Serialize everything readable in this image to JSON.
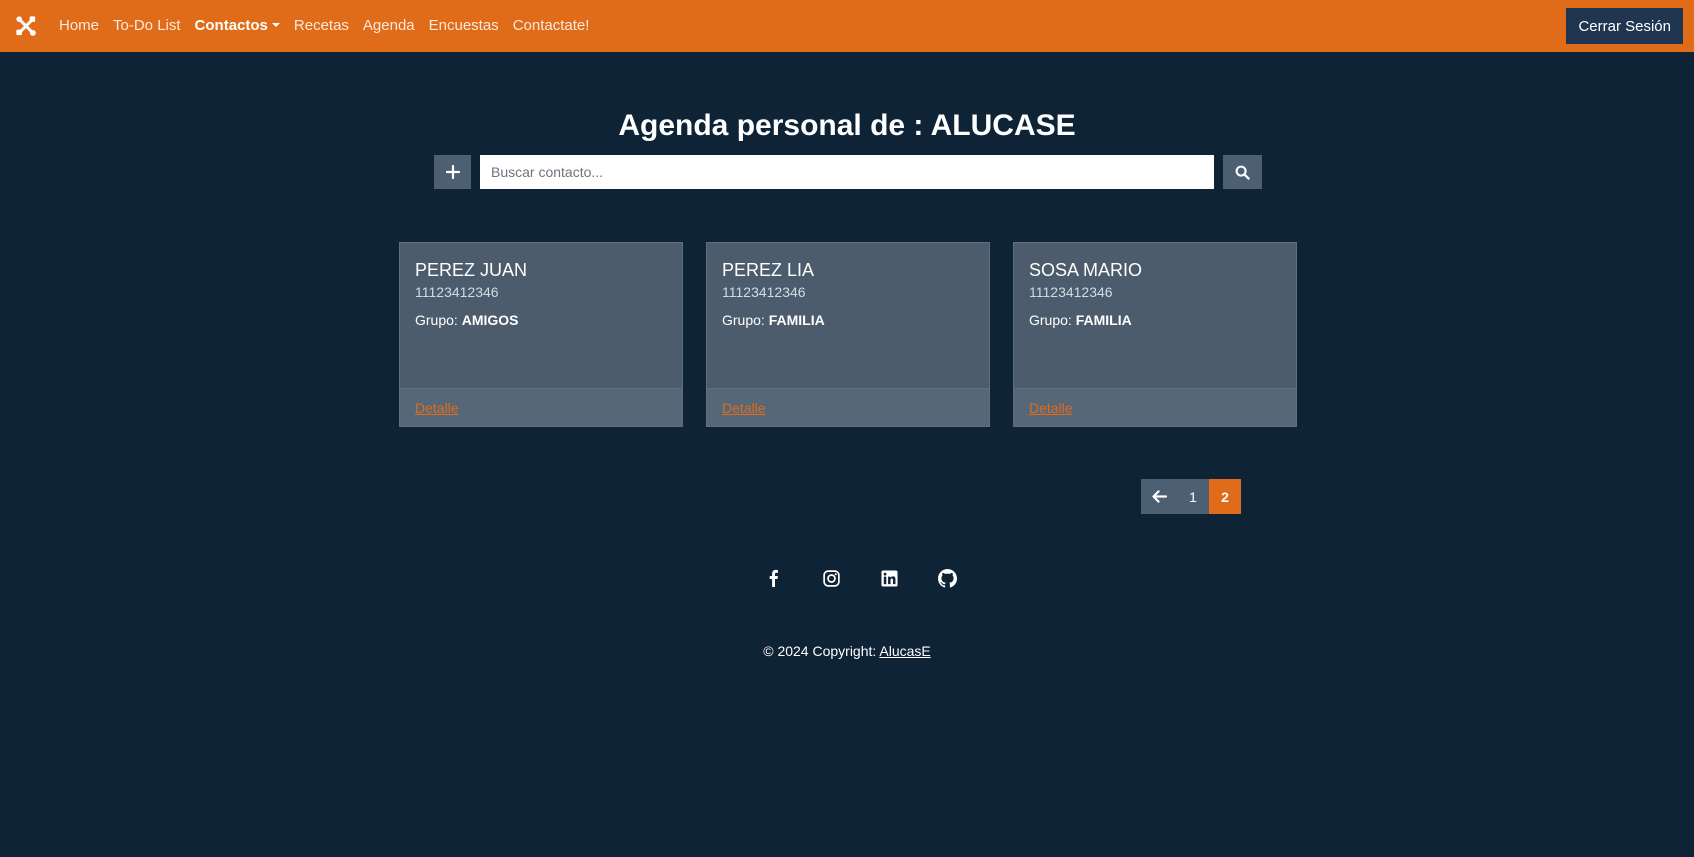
{
  "navbar": {
    "brand_icon": "tools-icon",
    "links": [
      "Home",
      "To-Do List",
      "Contactos",
      "Recetas",
      "Agenda",
      "Encuestas",
      "Contactate!"
    ],
    "logout_label": "Cerrar Sesión",
    "accent_color": "#e06c19"
  },
  "main": {
    "title": "Agenda personal de : ALUCASE",
    "add_icon": "plus-icon",
    "search_placeholder": "Buscar contacto...",
    "search_value": "",
    "search_icon": "search-icon"
  },
  "contacts": [
    {
      "name": "PEREZ JUAN",
      "phone": "11123412346",
      "group_label": "Grupo:",
      "group": "AMIGOS",
      "link": "Detalle"
    },
    {
      "name": "PEREZ LIA",
      "phone": "11123412346",
      "group_label": "Grupo:",
      "group": "FAMILIA",
      "link": "Detalle"
    },
    {
      "name": "SOSA MARIO",
      "phone": "11123412346",
      "group_label": "Grupo:",
      "group": "FAMILIA",
      "link": "Detalle"
    }
  ],
  "pagination": {
    "prev_icon": "arrow-left-icon",
    "pages": [
      "1",
      "2"
    ],
    "current": "2"
  },
  "footer": {
    "socials": [
      "facebook-icon",
      "instagram-icon",
      "linkedin-icon",
      "github-icon"
    ],
    "copyright_text": "© 2024 Copyright: ",
    "copyright_link": "AlucasE"
  }
}
